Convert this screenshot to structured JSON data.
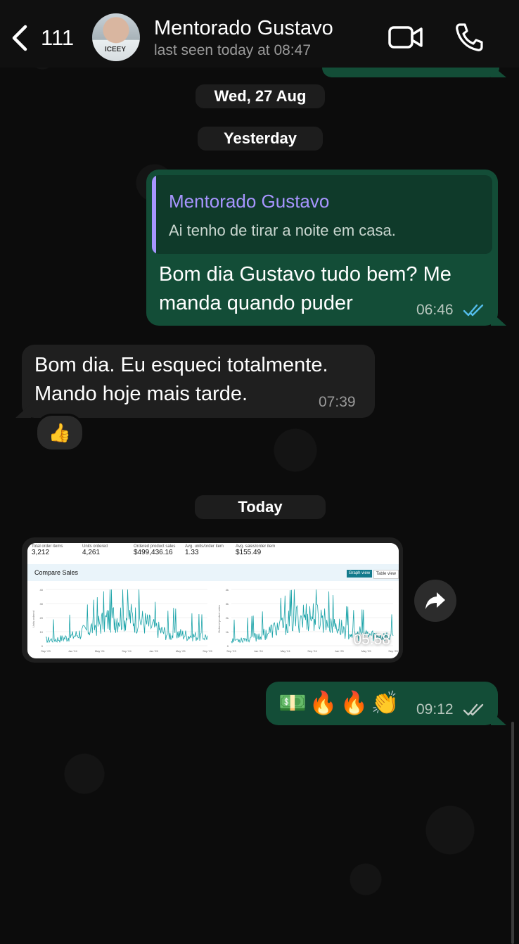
{
  "header": {
    "back_count": "111",
    "contact_name": "Mentorado Gustavo",
    "last_seen": "last seen today at 08:47",
    "avatar_shirt_text": "ICEEY"
  },
  "dates": {
    "wed": "Wed, 27 Aug",
    "yesterday": "Yesterday",
    "today": "Today"
  },
  "messages": {
    "out1": {
      "quote_name": "Mentorado Gustavo",
      "quote_text": "Ai tenho de tirar a noite em casa.",
      "line1": "Bom dia Gustavo tudo bem? Me",
      "line2": "manda quando puder",
      "time": "06:46",
      "status": "read"
    },
    "in1": {
      "line1": "Bom dia. Eu esqueci totalmente.",
      "line2": "Mando hoje mais tarde.",
      "time": "07:39",
      "reaction": "👍"
    },
    "image": {
      "time": "05:58",
      "metrics": [
        {
          "label": "Total order items",
          "value": "3,212"
        },
        {
          "label": "Units ordered",
          "value": "4,261"
        },
        {
          "label": "Ordered product sales",
          "value": "$499,436.16"
        },
        {
          "label": "Avg. units/order item",
          "value": "1.33"
        },
        {
          "label": "Avg. sales/order item",
          "value": "$155.49"
        }
      ],
      "compare_title": "Compare Sales",
      "graph_view": "Graph view",
      "table_view": "Table view",
      "left_ticks": [
        "40",
        "30",
        "20",
        "10",
        "0"
      ],
      "left_ylabel": "Units ordered",
      "right_ylabel": "Ordered product sales",
      "right_ticks": [
        "4k",
        "3k",
        "2k",
        "1k",
        "0"
      ],
      "x_ticks": [
        "Sep '23",
        "Jan '24",
        "May '24",
        "Sep '24",
        "Jan '25",
        "May '25",
        "Sep '25"
      ]
    },
    "out2": {
      "emojis": "💵🔥🔥👏",
      "time": "09:12",
      "status": "delivered"
    }
  },
  "colors": {
    "outgoing_bubble": "#134d37",
    "incoming_bubble": "#1f1f1f",
    "quote_accent": "#a795ff",
    "read_tick": "#53bdeb",
    "chart_line": "#1aa3a8"
  }
}
